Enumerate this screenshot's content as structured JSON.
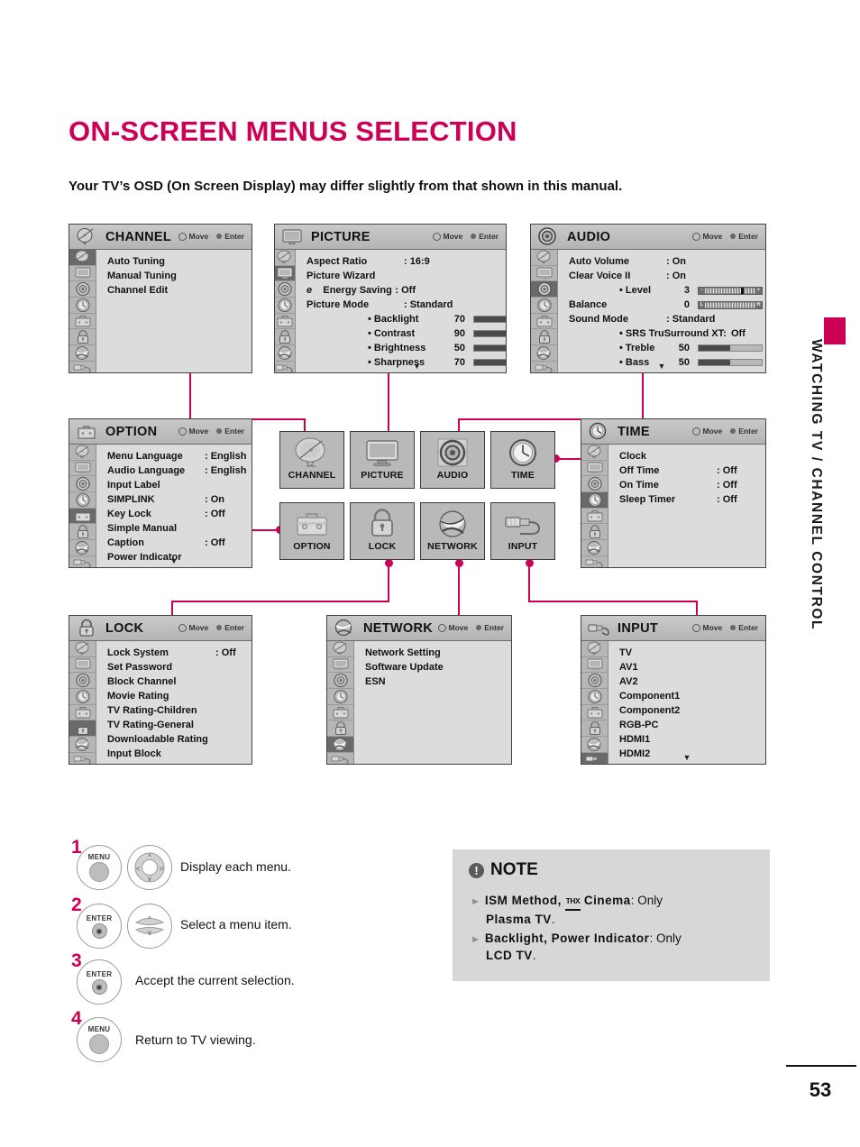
{
  "header": {
    "title": "ON-SCREEN MENUS SELECTION",
    "subtitle": "Your TV’s OSD (On Screen Display) may differ slightly from that shown in this manual."
  },
  "side_tab": {
    "label": "WATCHING TV / CHANNEL CONTROL"
  },
  "footer": {
    "page_number": "53"
  },
  "hints": {
    "move": "Move",
    "enter": "Enter"
  },
  "panels": {
    "channel": {
      "title": "CHANNEL",
      "selected_index": 0,
      "rows": [
        {
          "label": "Auto Tuning",
          "value": ""
        },
        {
          "label": "Manual Tuning",
          "value": ""
        },
        {
          "label": "Channel Edit",
          "value": ""
        }
      ]
    },
    "picture": {
      "title": "PICTURE",
      "selected_index": 1,
      "rows": [
        {
          "label": "Aspect Ratio",
          "value": ": 16:9"
        },
        {
          "label": "Picture Wizard",
          "value": ""
        },
        {
          "label": "Energy Saving",
          "value": ": Off",
          "eco": true
        },
        {
          "label": "Picture Mode",
          "value": ": Standard"
        }
      ],
      "sliders": [
        {
          "label": "• Backlight",
          "value": "70",
          "percent": 70
        },
        {
          "label": "• Contrast",
          "value": "90",
          "percent": 90
        },
        {
          "label": "• Brightness",
          "value": "50",
          "percent": 50
        },
        {
          "label": "• Sharpness",
          "value": "70",
          "percent": 70
        }
      ],
      "more": "▼"
    },
    "audio": {
      "title": "AUDIO",
      "selected_index": 2,
      "rows": [
        {
          "label": "Auto Volume",
          "value": ": On"
        },
        {
          "label": "Clear Voice II",
          "value": ": On"
        },
        {
          "label": "• Level",
          "value": "3",
          "scale": "level"
        },
        {
          "label": "Balance",
          "value": "0",
          "scale": "balance"
        },
        {
          "label": "Sound Mode",
          "value": ": Standard"
        },
        {
          "label": "• SRS TruSurround XT:",
          "value": "Off"
        },
        {
          "label": "• Treble",
          "value": "50",
          "percent": 50
        },
        {
          "label": "• Bass",
          "value": "50",
          "percent": 50
        }
      ],
      "more": "▼"
    },
    "option": {
      "title": "OPTION",
      "selected_index": 4,
      "rows": [
        {
          "label": "Menu Language",
          "value": ": English"
        },
        {
          "label": "Audio Language",
          "value": ": English"
        },
        {
          "label": "Input Label",
          "value": ""
        },
        {
          "label": "SIMPLINK",
          "value": ": On"
        },
        {
          "label": "Key Lock",
          "value": ": Off"
        },
        {
          "label": "Simple Manual",
          "value": ""
        },
        {
          "label": "Caption",
          "value": ": Off"
        },
        {
          "label": "Power Indicator",
          "value": ""
        }
      ],
      "more": "▼"
    },
    "time": {
      "title": "TIME",
      "selected_index": 3,
      "rows": [
        {
          "label": "Clock",
          "value": ""
        },
        {
          "label": "Off Time",
          "value": ": Off"
        },
        {
          "label": "On Time",
          "value": ": Off"
        },
        {
          "label": "Sleep Timer",
          "value": ": Off"
        }
      ]
    },
    "lock": {
      "title": "LOCK",
      "selected_index": 5,
      "rows": [
        {
          "label": "Lock System",
          "value": ": Off"
        },
        {
          "label": "Set Password",
          "value": ""
        },
        {
          "label": "Block Channel",
          "value": ""
        },
        {
          "label": "Movie Rating",
          "value": ""
        },
        {
          "label": "TV Rating-Children",
          "value": ""
        },
        {
          "label": "TV Rating-General",
          "value": ""
        },
        {
          "label": "Downloadable Rating",
          "value": ""
        },
        {
          "label": "Input Block",
          "value": ""
        }
      ]
    },
    "network": {
      "title": "NETWORK",
      "selected_index": 6,
      "rows": [
        {
          "label": "Network Setting",
          "value": ""
        },
        {
          "label": "Software Update",
          "value": ""
        },
        {
          "label": "ESN",
          "value": ""
        }
      ]
    },
    "input": {
      "title": "INPUT",
      "selected_index": 7,
      "rows": [
        {
          "label": "TV",
          "value": ""
        },
        {
          "label": "AV1",
          "value": ""
        },
        {
          "label": "AV2",
          "value": ""
        },
        {
          "label": "Component1",
          "value": ""
        },
        {
          "label": "Component2",
          "value": ""
        },
        {
          "label": "RGB-PC",
          "value": ""
        },
        {
          "label": "HDMI1",
          "value": ""
        },
        {
          "label": "HDMI2",
          "value": ""
        }
      ],
      "more": "▼"
    }
  },
  "tiles": [
    {
      "label": "CHANNEL",
      "icon": "satellite-dish-icon"
    },
    {
      "label": "PICTURE",
      "icon": "monitor-icon"
    },
    {
      "label": "AUDIO",
      "icon": "speaker-icon"
    },
    {
      "label": "TIME",
      "icon": "clock-icon"
    },
    {
      "label": "OPTION",
      "icon": "toolbox-icon"
    },
    {
      "label": "LOCK",
      "icon": "padlock-icon"
    },
    {
      "label": "NETWORK",
      "icon": "globe-icon"
    },
    {
      "label": "INPUT",
      "icon": "plug-icon"
    }
  ],
  "steps": [
    {
      "num": "1",
      "buttons": [
        "MENU",
        "DPAD"
      ],
      "text": "Display each menu."
    },
    {
      "num": "2",
      "buttons": [
        "ENTER",
        "UPDOWN"
      ],
      "text": "Select a menu item."
    },
    {
      "num": "3",
      "buttons": [
        "ENTER"
      ],
      "text": "Accept the current selection."
    },
    {
      "num": "4",
      "buttons": [
        "MENU"
      ],
      "text": "Return to TV viewing."
    }
  ],
  "button_labels": {
    "menu": "MENU",
    "enter": "ENTER"
  },
  "note": {
    "title": "NOTE",
    "bang": "!",
    "items": [
      {
        "bold_a": "ISM Method,",
        "thx": "THX",
        "bold_b": "Cinema",
        "rest": ": Only",
        "second_line_bold": "Plasma TV",
        "second_line_rest": "."
      },
      {
        "bold_a": "Backlight, Power Indicator",
        "rest": ": Only",
        "second_line_bold": "LCD TV",
        "second_line_rest": "."
      }
    ]
  },
  "colors": {
    "accent": "#cc0055",
    "osd_bg": "#dcdcdc",
    "rail": "#b6b6b6",
    "rail_sel": "#6a6a6a"
  }
}
